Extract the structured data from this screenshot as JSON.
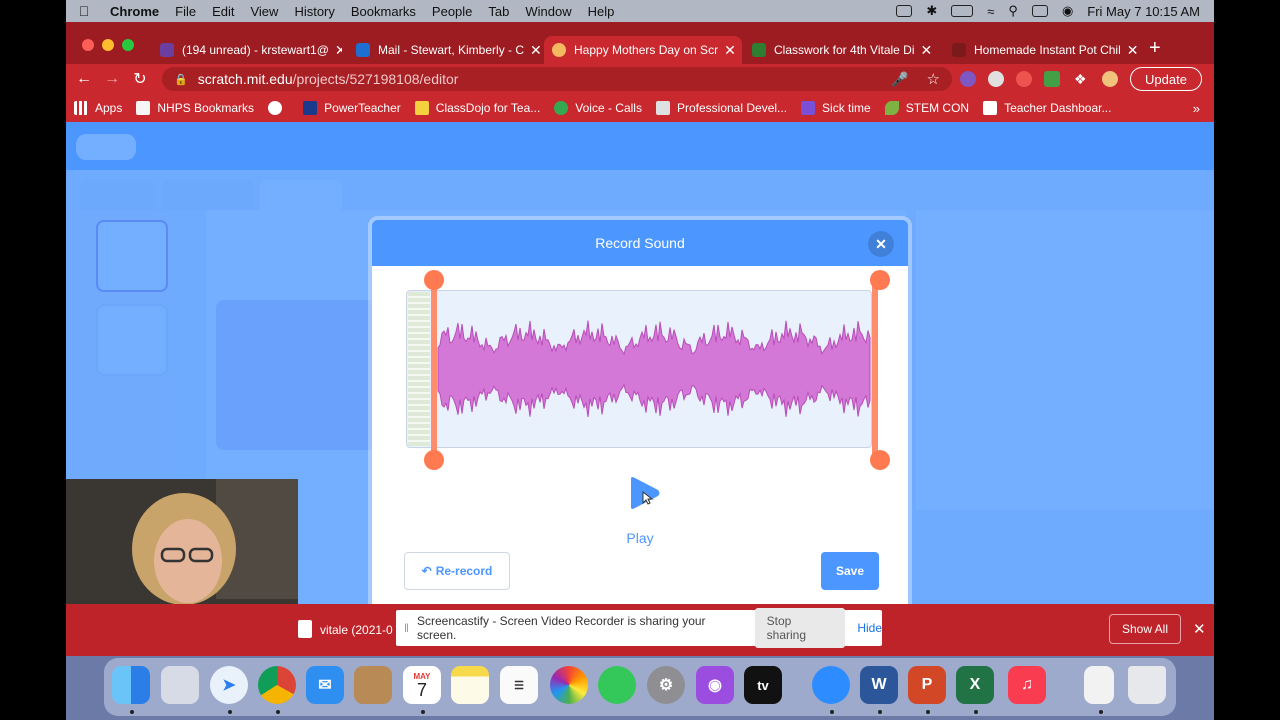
{
  "menubar": {
    "items": [
      "Chrome",
      "File",
      "Edit",
      "View",
      "History",
      "Bookmarks",
      "People",
      "Tab",
      "Window",
      "Help"
    ],
    "clock": "Fri May 7  10:15 AM"
  },
  "tabs": [
    {
      "label": "(194 unread) - krstewart1@",
      "color": "#6b3fa0"
    },
    {
      "label": "Mail - Stewart, Kimberly - C",
      "color": "#1e6fd0"
    },
    {
      "label": "Happy Mothers Day on Scr",
      "color": "#f4b860"
    },
    {
      "label": "Classwork for 4th Vitale Di",
      "color": "#2e7d32"
    },
    {
      "label": "Homemade Instant Pot Chil",
      "color": "#7a1a1a"
    }
  ],
  "address": {
    "host": "scratch.mit.edu",
    "path": "/projects/527198108/editor"
  },
  "update_label": "Update",
  "bookmarks": [
    {
      "label": "Apps",
      "color": "#ffffff"
    },
    {
      "label": "NHPS Bookmarks",
      "color": "#ffffff"
    },
    {
      "label": "",
      "color": "#ffffff"
    },
    {
      "label": "PowerTeacher",
      "color": "#1b3a8a"
    },
    {
      "label": "ClassDojo for Tea...",
      "color": "#f4d03f"
    },
    {
      "label": "Voice - Calls",
      "color": "#34a853"
    },
    {
      "label": "Professional Devel...",
      "color": "#ffffff"
    },
    {
      "label": "Sick time",
      "color": "#7b4fd6"
    },
    {
      "label": "STEM CON",
      "color": "#7cb342"
    },
    {
      "label": "Teacher Dashboar...",
      "color": "#ffffff"
    }
  ],
  "modal": {
    "title": "Record Sound",
    "play_label": "Play",
    "rerecord_label": "Re-record",
    "save_label": "Save"
  },
  "download": {
    "filename": "vitale (2021-0",
    "show_all": "Show All"
  },
  "share_bar": {
    "message": "Screencastify - Screen Video Recorder is sharing your screen.",
    "stop_label": "Stop sharing",
    "hide_label": "Hide"
  },
  "dock": {
    "calendar_month": "MAY",
    "calendar_day": "7",
    "tv_label": "tv"
  },
  "colors": {
    "scratch_blue": "#4c97ff",
    "waveform": "#cf63cf",
    "trim_handle": "#ff7a50",
    "chrome_red": "#c8282e"
  }
}
